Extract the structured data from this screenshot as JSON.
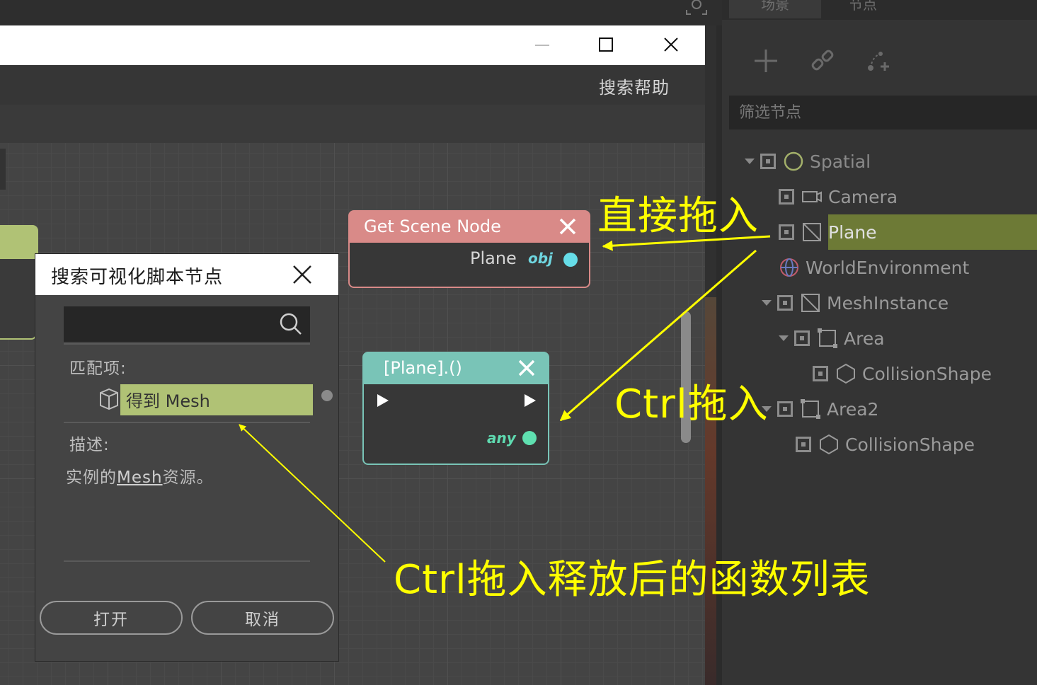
{
  "dock": {
    "tabs": [
      "场景",
      "节点"
    ],
    "filter_placeholder": "筛选节点",
    "tree": [
      {
        "label": "Spatial",
        "icon": "spatial-icon",
        "color": "#a3b06a"
      },
      {
        "label": "Camera",
        "icon": "camera-icon"
      },
      {
        "label": "Plane",
        "icon": "mesh-instance-icon",
        "selected": true
      },
      {
        "label": "WorldEnvironment",
        "icon": "world-environment-icon"
      },
      {
        "label": "MeshInstance",
        "icon": "mesh-instance-icon"
      },
      {
        "label": "Area",
        "icon": "area-icon"
      },
      {
        "label": "CollisionShape",
        "icon": "collision-shape-icon"
      },
      {
        "label": "Area2",
        "icon": "area-icon"
      },
      {
        "label": "CollisionShape",
        "icon": "collision-shape-icon"
      }
    ]
  },
  "window": {
    "help_label": "搜索帮助"
  },
  "nodes": {
    "get_scene": {
      "title": "Get Scene Node",
      "port_label": "Plane",
      "port_type": "obj",
      "color": "#d98a88"
    },
    "plane_call": {
      "title": "[Plane].()",
      "port_type": "any",
      "color": "#79c4b7"
    }
  },
  "popup": {
    "title": "搜索可视化脚本节点",
    "search_value": "",
    "matches_label": "匹配项:",
    "result_label": "得到 Mesh",
    "desc_label": "描述:",
    "desc_prefix": "实例的",
    "desc_link": "Mesh",
    "desc_suffix": "资源。",
    "open_label": "打开",
    "cancel_label": "取消"
  },
  "annotations": {
    "direct_drag": "直接拖入",
    "ctrl_drag": "Ctrl拖入",
    "ctrl_release": "Ctrl拖入释放后的函数列表",
    "color": "#ffff00"
  }
}
